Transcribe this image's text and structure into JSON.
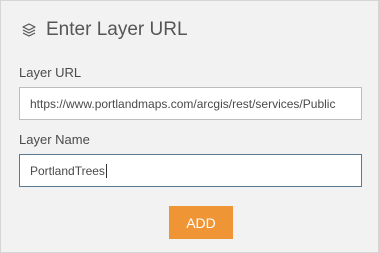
{
  "header": {
    "icon": "layers-icon",
    "title": "Enter Layer URL"
  },
  "layer_url": {
    "label": "Layer URL",
    "value": "https://www.portlandmaps.com/arcgis/rest/services/Public"
  },
  "layer_name": {
    "label": "Layer Name",
    "value": "PortlandTrees"
  },
  "actions": {
    "add_label": "ADD"
  },
  "colors": {
    "add_button": "#ef9535",
    "panel_background": "#f2f2f2",
    "active_field_border": "#5a7a94"
  }
}
